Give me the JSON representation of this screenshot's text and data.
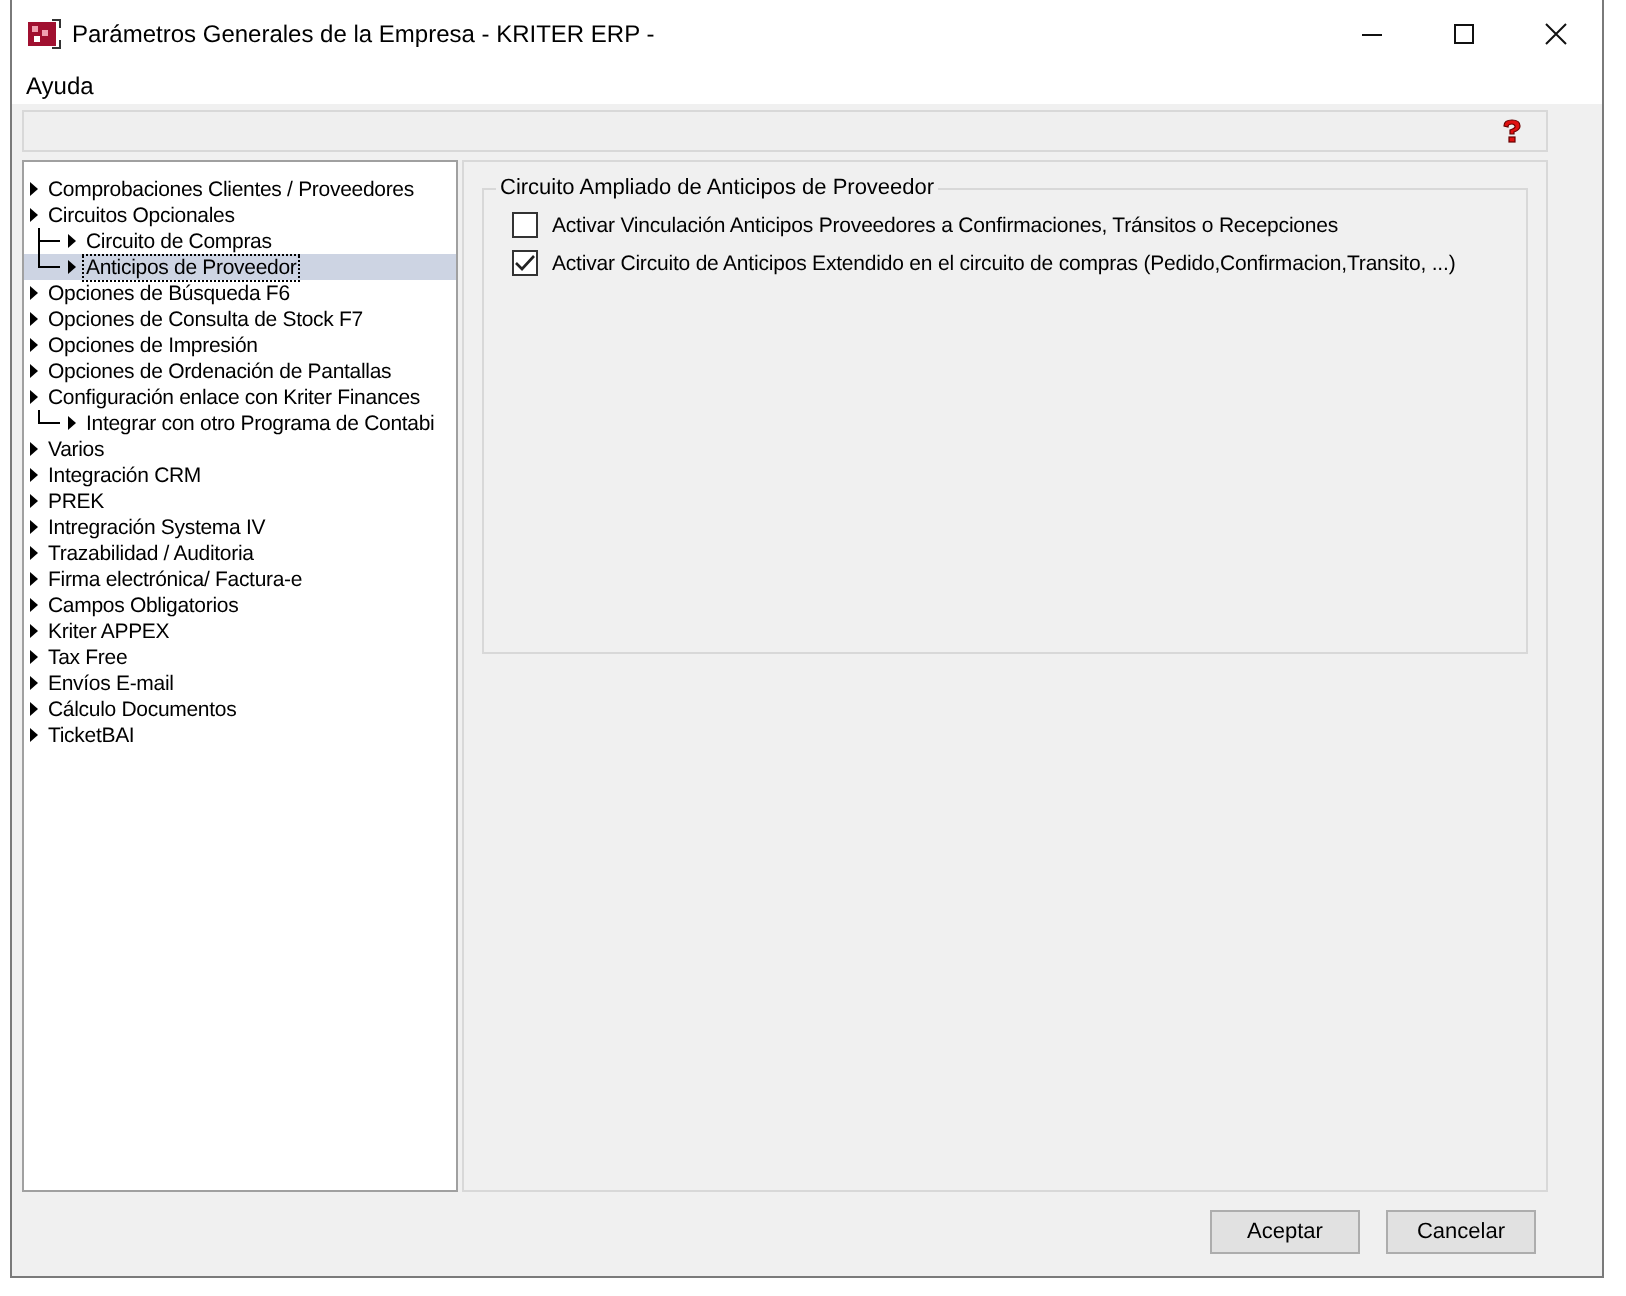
{
  "window": {
    "title": "Parámetros Generales de la Empresa - KRITER ERP -"
  },
  "menu": [
    {
      "label": "Ayuda"
    }
  ],
  "tree": [
    {
      "label": "Comprobaciones Clientes / Proveedores",
      "selected": false
    },
    {
      "label": "Circuitos Opcionales",
      "selected": false,
      "children": [
        {
          "label": "Circuito de Compras",
          "selected": false
        },
        {
          "label": "Anticipos de Proveedor",
          "selected": true
        }
      ]
    },
    {
      "label": "Opciones de Búsqueda F6",
      "selected": false
    },
    {
      "label": "Opciones de Consulta de Stock F7",
      "selected": false
    },
    {
      "label": "Opciones de Impresión",
      "selected": false
    },
    {
      "label": "Opciones de Ordenación de Pantallas",
      "selected": false
    },
    {
      "label": "Configuración enlace con Kriter Finances",
      "selected": false,
      "children": [
        {
          "label": "Integrar con otro Programa de Contabi",
          "selected": false
        }
      ]
    },
    {
      "label": "Varios",
      "selected": false
    },
    {
      "label": "Integración CRM",
      "selected": false
    },
    {
      "label": "PREK",
      "selected": false
    },
    {
      "label": "Intregración Systema IV",
      "selected": false
    },
    {
      "label": "Trazabilidad / Auditoria",
      "selected": false
    },
    {
      "label": "Firma electrónica/ Factura-e",
      "selected": false
    },
    {
      "label": "Campos Obligatorios",
      "selected": false
    },
    {
      "label": "Kriter APPEX",
      "selected": false
    },
    {
      "label": "Tax Free",
      "selected": false
    },
    {
      "label": "Envíos E-mail",
      "selected": false
    },
    {
      "label": "Cálculo Documentos",
      "selected": false
    },
    {
      "label": "TicketBAI",
      "selected": false
    }
  ],
  "group": {
    "title": "Circuito Ampliado de Anticipos de Proveedor",
    "options": [
      {
        "label": "Activar Vinculación Anticipos Proveedores a Confirmaciones, Tránsitos o Recepciones",
        "checked": false
      },
      {
        "label": "Activar Circuito de Anticipos Extendido en el circuito de compras (Pedido,Confirmacion,Transito, ...)",
        "checked": true
      }
    ]
  },
  "buttons": [
    {
      "label": "Aceptar"
    },
    {
      "label": "Cancelar"
    }
  ]
}
